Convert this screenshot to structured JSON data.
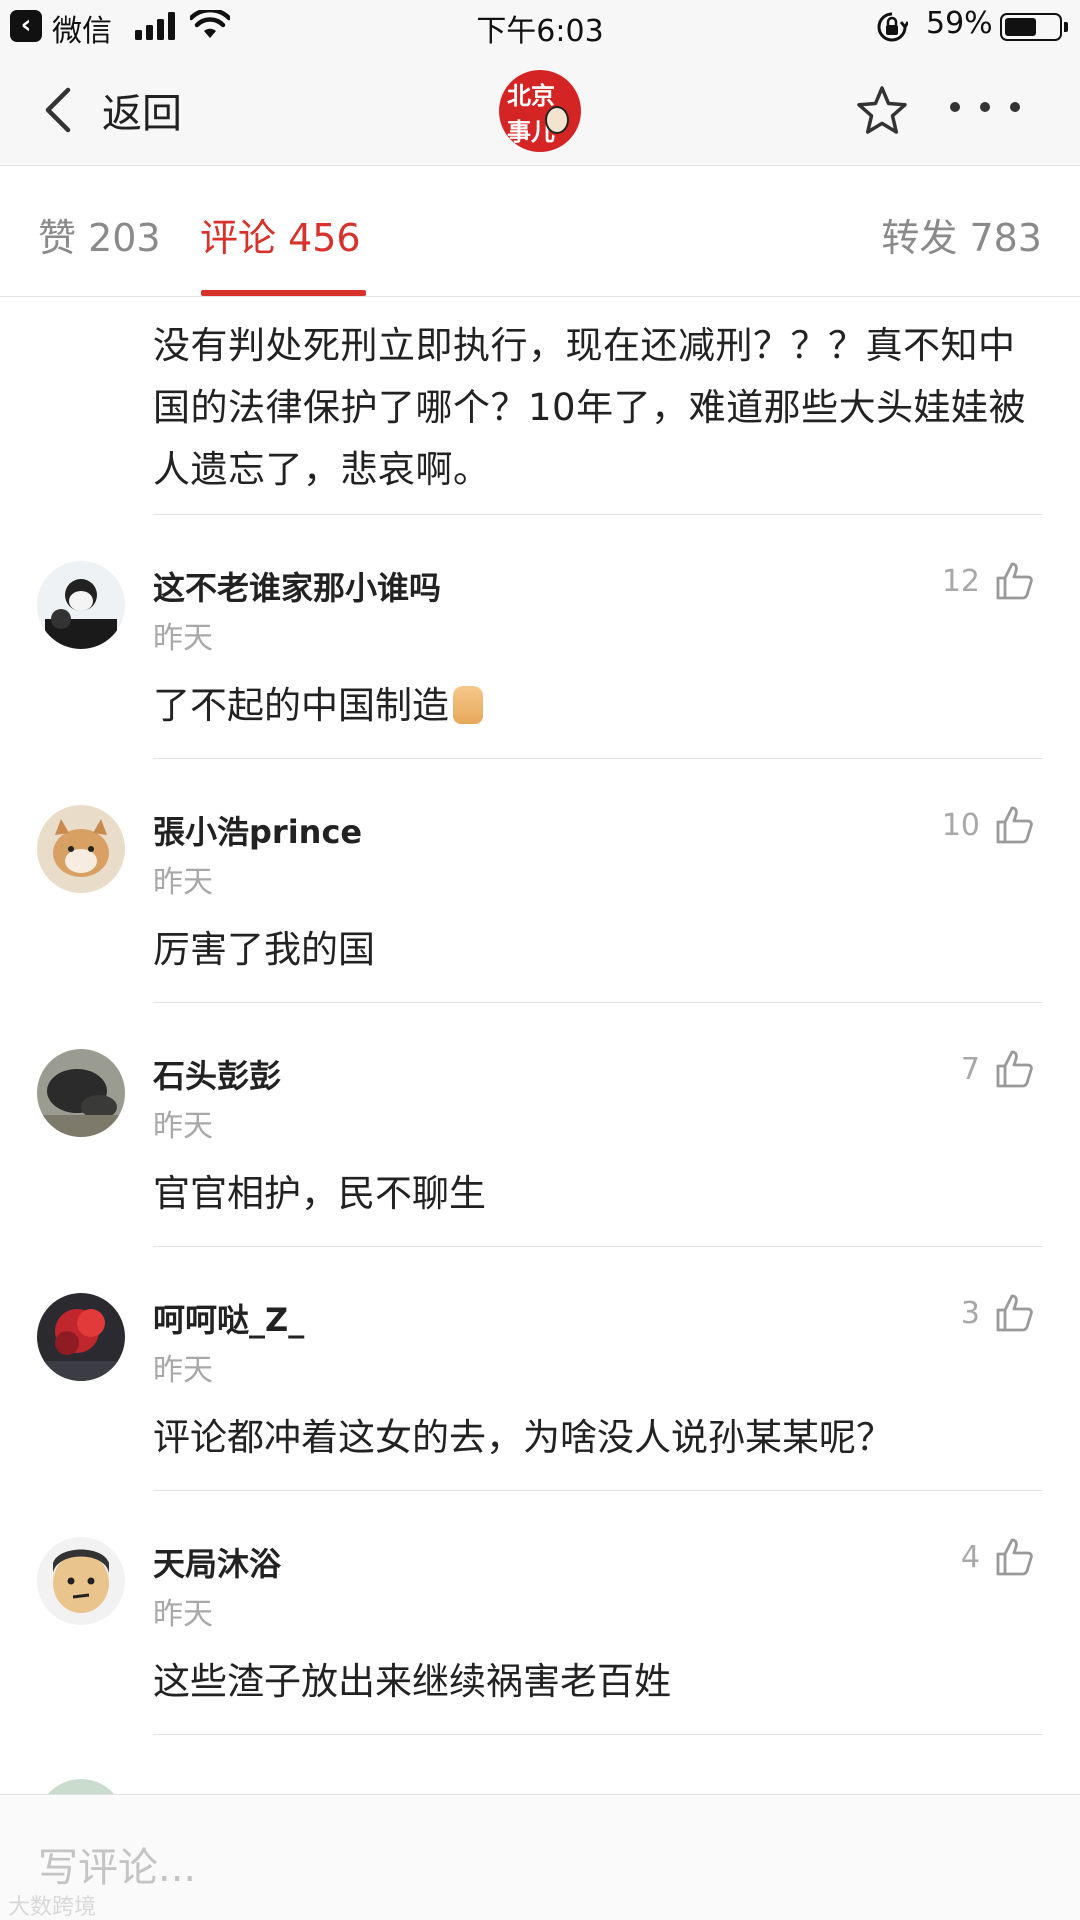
{
  "status_bar": {
    "app_name": "微信",
    "time": "下午6:03",
    "battery_text": "59%",
    "battery_level": 0.59,
    "icons": [
      "back-arrow-icon",
      "signal-icon",
      "wifi-icon",
      "orientation-lock-icon",
      "battery-icon"
    ]
  },
  "nav": {
    "back_label": "返回",
    "logo_line1": "北京",
    "logo_line2": "事儿",
    "icons": [
      "chevron-left-icon",
      "star-icon",
      "more-icon"
    ]
  },
  "tabs": {
    "likes": "赞 203",
    "comments": "评论 456",
    "shares": "转发 783",
    "active": "comments",
    "accent_color": "#d8322c"
  },
  "previous_comment": {
    "text": "没有判处死刑立即执行，现在还减刑？？？真不知中国的法律保护了哪个？10年了，难道那些大头娃娃被人遗忘了，悲哀啊。"
  },
  "comments": [
    {
      "name": "这不老谁家那小谁吗",
      "time": "昨天",
      "text": "了不起的中国制造",
      "likes": "12"
    },
    {
      "name": "張小浩prince",
      "time": "昨天",
      "text": "厉害了我的国",
      "likes": "10"
    },
    {
      "name": "石头彭彭",
      "time": "昨天",
      "text": "官官相护，民不聊生",
      "likes": "7"
    },
    {
      "name": "呵呵哒_Z_",
      "time": "昨天",
      "text": "评论都冲着这女的去，为啥没人说孙某某呢？",
      "likes": "3"
    },
    {
      "name": "天局沐浴",
      "time": "昨天",
      "text": "这些渣子放出来继续祸害老百姓",
      "likes": "4"
    }
  ],
  "input": {
    "placeholder": "写评论..."
  },
  "watermark": "大数跨境"
}
